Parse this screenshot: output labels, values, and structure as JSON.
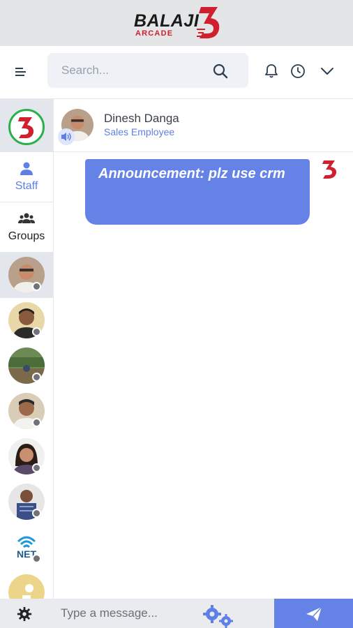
{
  "brand": {
    "name": "BALAJI",
    "sub": "ARCADE",
    "mark": "3"
  },
  "toolbar": {
    "search_placeholder": "Search...",
    "icons": [
      "menu-icon",
      "search-icon",
      "bell-icon",
      "clock-icon",
      "chevron-down-icon"
    ]
  },
  "sidebar": {
    "tabs": [
      {
        "label": "Staff",
        "icon": "user-icon"
      },
      {
        "label": "Groups",
        "icon": "users-icon"
      }
    ],
    "contacts": [
      {
        "name": "contact-1",
        "online": false,
        "active": true
      },
      {
        "name": "contact-2",
        "online": false
      },
      {
        "name": "contact-3",
        "online": false
      },
      {
        "name": "contact-4",
        "online": false
      },
      {
        "name": "contact-5",
        "online": false
      },
      {
        "name": "contact-6",
        "online": false
      },
      {
        "name": "contact-7",
        "online": false,
        "logo_text": "NET"
      },
      {
        "name": "contact-8",
        "online": false
      }
    ],
    "footer_icon": "gear-icon"
  },
  "chat": {
    "contact_name": "Dinesh Danga",
    "contact_role": "Sales Employee",
    "messages": [
      {
        "text": "Announcement: plz use crm",
        "outgoing": true
      }
    ]
  },
  "composer": {
    "placeholder": "Type a message...",
    "icons": [
      "gears-icon",
      "send-icon"
    ]
  },
  "colors": {
    "accent": "#6583e6",
    "brand_red": "#d0202f",
    "brand_green": "#2ab04a",
    "status_offline": "#6f7378"
  }
}
